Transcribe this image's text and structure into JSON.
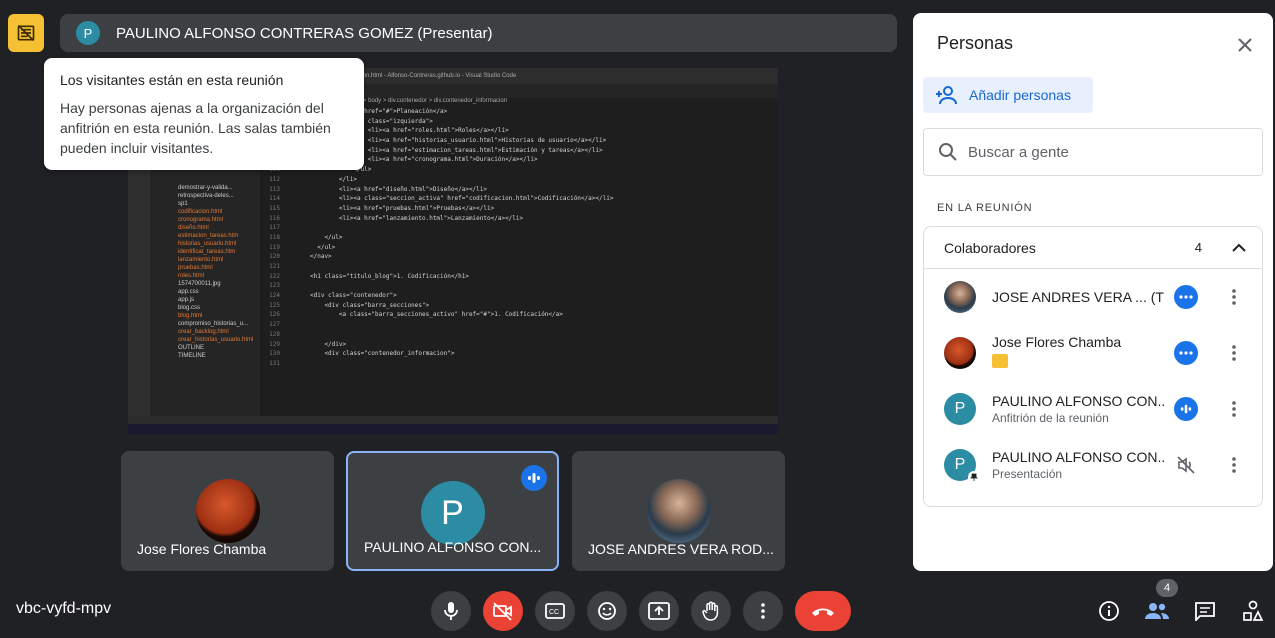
{
  "meeting": {
    "code": "vbc-vyfd-mpv"
  },
  "presenter_bar": {
    "avatar_letter": "P",
    "label": "PAULINO ALFONSO CONTRERAS GOMEZ (Presentar)"
  },
  "visitor_notice": {
    "title": "Los visitantes están en esta reunión",
    "body": "Hay personas ajenas a la organización del anfitrión en esta reunión. Las salas también pueden incluir visitantes."
  },
  "shared_screen": {
    "window_title": "codificacion.html - Alfonso-Contreras.github.io - Visual Studio Code",
    "breadcrumb": "html > body > div.contenedor > div.contenedor_informacion",
    "sidebar_files": [
      "demostrar-y-valida...",
      "retrospectiva-deles...",
      "sp1",
      "codificacion.html",
      "cronograma.html",
      "diseño.html",
      "estimacion_tareas.htm",
      "historias_usuario.html",
      "identificar_tareas.htm",
      "lanzamiento.html",
      "pruebas.html",
      "roles.html",
      "1574700011.jpg",
      "app.css",
      "app.js",
      "blog.css",
      "blog.html",
      "compromiso_historias_u...",
      "crear_backlog.html",
      "crear_historias_usuario.html",
      "OUTLINE",
      "TIMELINE"
    ],
    "code_lines": [
      {
        "n": "105",
        "t": "        <li><a href=\"#\">Planeación</a>"
      },
      {
        "n": "106",
        "t": "            <ul class=\"izquierda\">"
      },
      {
        "n": "107",
        "t": "                <li><a href=\"roles.html\">Roles</a></li>"
      },
      {
        "n": "108",
        "t": "                <li><a href=\"historias_usuario.html\">Historias de usuario</a></li>"
      },
      {
        "n": "109",
        "t": "                <li><a href=\"estimacion_tareas.html\">Estimación y tareas</a></li>"
      },
      {
        "n": "110",
        "t": "                <li><a href=\"cronograma.html\">Duración</a></li>"
      },
      {
        "n": "111",
        "t": "            </ul>"
      },
      {
        "n": "112",
        "t": "        </li>"
      },
      {
        "n": "113",
        "t": "        <li><a href=\"diseño.html\">Diseño</a></li>"
      },
      {
        "n": "114",
        "t": "        <li><a class=\"seccion_activa\" href=\"codificacion.html\">Codificación</a></li>"
      },
      {
        "n": "115",
        "t": "        <li><a href=\"pruebas.html\">Pruebas</a></li>"
      },
      {
        "n": "116",
        "t": "        <li><a href=\"lanzamiento.html\">Lanzamiento</a></li>"
      },
      {
        "n": "117",
        "t": ""
      },
      {
        "n": "118",
        "t": "    </ul>"
      },
      {
        "n": "119",
        "t": "  </ul>"
      },
      {
        "n": "120",
        "t": "</nav>"
      },
      {
        "n": "121",
        "t": ""
      },
      {
        "n": "122",
        "t": "<h1 class=\"titulo_blog\">1. Codificación</h1>"
      },
      {
        "n": "123",
        "t": ""
      },
      {
        "n": "124",
        "t": "<div class=\"contenedor\">"
      },
      {
        "n": "125",
        "t": "    <div class=\"barra_secciones\">"
      },
      {
        "n": "126",
        "t": "        <a class=\"barra_secciones_activo\" href=\"#\">1. Codificación</a>"
      },
      {
        "n": "127",
        "t": ""
      },
      {
        "n": "128",
        "t": ""
      },
      {
        "n": "129",
        "t": "    </div>"
      },
      {
        "n": "130",
        "t": "    <div class=\"contenedor_informacion\">"
      },
      {
        "n": "131",
        "t": ""
      }
    ]
  },
  "tiles": [
    {
      "name": "Jose Flores Chamba"
    },
    {
      "avatar_letter": "P",
      "name": "PAULINO ALFONSO CON..."
    },
    {
      "name": "JOSE ANDRES VERA ROD..."
    }
  ],
  "people_panel": {
    "title": "Personas",
    "add_people_label": "Añadir personas",
    "search_placeholder": "Buscar a gente",
    "section_label": "EN LA REUNIÓN",
    "group": {
      "name": "Colaboradores",
      "count": "4"
    },
    "participants": [
      {
        "name": "JOSE ANDRES VERA ...",
        "suffix": "(Tú)",
        "subtitle": ""
      },
      {
        "name": "Jose Flores Chamba",
        "subtitle": ""
      },
      {
        "avatar_letter": "P",
        "name": "PAULINO ALFONSO CON...",
        "subtitle": "Anfitrión de la reunión"
      },
      {
        "avatar_letter": "P",
        "name": "PAULINO ALFONSO CON...",
        "subtitle": "Presentación"
      }
    ]
  },
  "controls": {
    "people_count": "4"
  },
  "colors": {
    "accent": "#1a73e8",
    "danger": "#ea4335",
    "warning": "#f6c034",
    "avatar_teal": "#2b8ca3"
  }
}
